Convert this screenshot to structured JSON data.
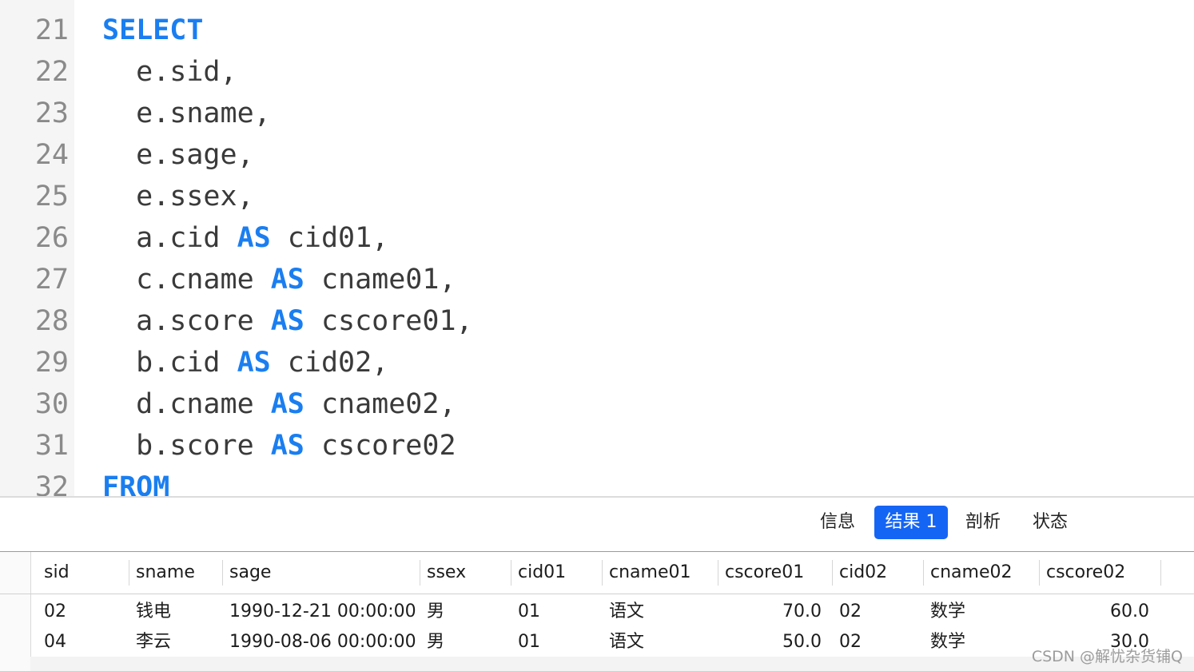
{
  "editor": {
    "lines": [
      {
        "num": "21",
        "tokens": [
          {
            "t": "SELECT",
            "kw": true
          }
        ]
      },
      {
        "num": "22",
        "tokens": [
          {
            "t": "  e.sid,",
            "kw": false
          }
        ]
      },
      {
        "num": "23",
        "tokens": [
          {
            "t": "  e.sname,",
            "kw": false
          }
        ]
      },
      {
        "num": "24",
        "tokens": [
          {
            "t": "  e.sage,",
            "kw": false
          }
        ]
      },
      {
        "num": "25",
        "tokens": [
          {
            "t": "  e.ssex,",
            "kw": false
          }
        ]
      },
      {
        "num": "26",
        "tokens": [
          {
            "t": "  a.cid ",
            "kw": false
          },
          {
            "t": "AS",
            "kw": true
          },
          {
            "t": " cid01,",
            "kw": false
          }
        ]
      },
      {
        "num": "27",
        "tokens": [
          {
            "t": "  c.cname ",
            "kw": false
          },
          {
            "t": "AS",
            "kw": true
          },
          {
            "t": " cname01,",
            "kw": false
          }
        ]
      },
      {
        "num": "28",
        "tokens": [
          {
            "t": "  a.score ",
            "kw": false
          },
          {
            "t": "AS",
            "kw": true
          },
          {
            "t": " cscore01,",
            "kw": false
          }
        ]
      },
      {
        "num": "29",
        "tokens": [
          {
            "t": "  b.cid ",
            "kw": false
          },
          {
            "t": "AS",
            "kw": true
          },
          {
            "t": " cid02,",
            "kw": false
          }
        ]
      },
      {
        "num": "30",
        "tokens": [
          {
            "t": "  d.cname ",
            "kw": false
          },
          {
            "t": "AS",
            "kw": true
          },
          {
            "t": " cname02,",
            "kw": false
          }
        ]
      },
      {
        "num": "31",
        "tokens": [
          {
            "t": "  b.score ",
            "kw": false
          },
          {
            "t": "AS",
            "kw": true
          },
          {
            "t": " cscore02",
            "kw": false
          }
        ]
      },
      {
        "num": "32",
        "tokens": [
          {
            "t": "FROM",
            "kw": true
          }
        ]
      }
    ]
  },
  "tabs": [
    {
      "label": "信息",
      "active": false
    },
    {
      "label": "结果 1",
      "active": true
    },
    {
      "label": "剖析",
      "active": false
    },
    {
      "label": "状态",
      "active": false
    }
  ],
  "table": {
    "columns": [
      "sid",
      "sname",
      "sage",
      "ssex",
      "cid01",
      "cname01",
      "cscore01",
      "cid02",
      "cname02",
      "cscore02"
    ],
    "numeric_columns": [
      6,
      9
    ],
    "rows": [
      [
        "02",
        "钱电",
        "1990-12-21 00:00:00",
        "男",
        "01",
        "语文",
        "70.0",
        "02",
        "数学",
        "60.0"
      ],
      [
        "04",
        "李云",
        "1990-08-06 00:00:00",
        "男",
        "01",
        "语文",
        "50.0",
        "02",
        "数学",
        "30.0"
      ]
    ]
  },
  "watermark": "CSDN @解忧杂货铺Q",
  "colors": {
    "keyword": "#1a7ef0",
    "active_tab": "#1565f5"
  }
}
